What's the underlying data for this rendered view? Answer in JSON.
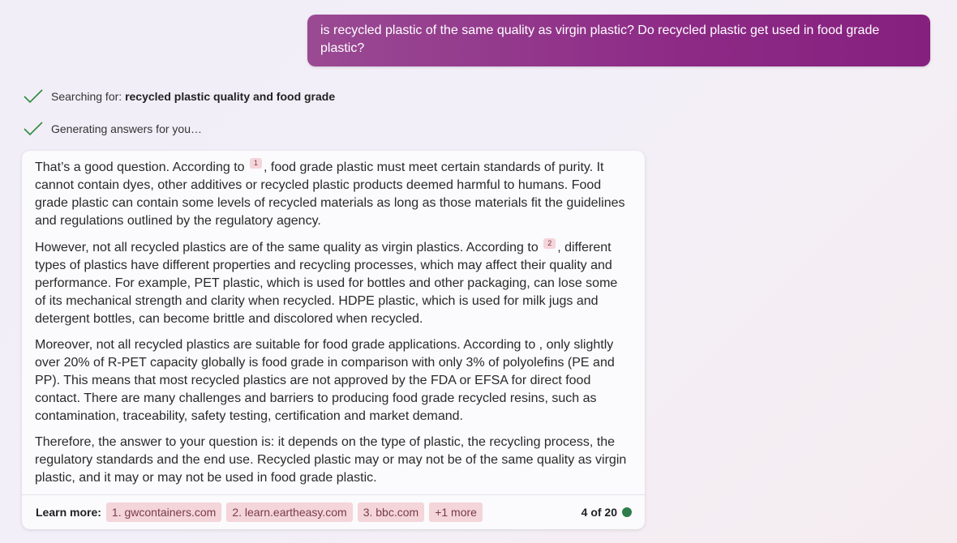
{
  "user_message": "is recycled plastic of the same quality as virgin plastic? Do recycled plastic get used in food grade plastic?",
  "status": {
    "searching_prefix": "Searching for: ",
    "searching_query": "recycled plastic quality and food grade",
    "generating": "Generating answers for you…"
  },
  "answer": {
    "p1_a": "That’s a good question. According to ",
    "p1_cite": "1",
    "p1_b": ", food grade plastic must meet certain standards of purity. It cannot contain dyes, other additives or recycled plastic products deemed harmful to humans. Food grade plastic can contain some levels of recycled materials as long as those materials fit the guidelines and regulations outlined by the regulatory agency.",
    "p2_a": "However, not all recycled plastics are of the same quality as virgin plastics. According to ",
    "p2_cite": "2",
    "p2_b": ", different types of plastics have different properties and recycling processes, which may affect their quality and performance. For example, PET plastic, which is used for bottles and other packaging, can lose some of its mechanical strength and clarity when recycled. HDPE plastic, which is used for milk jugs and detergent bottles, can become brittle and discolored when recycled.",
    "p3": "Moreover, not all recycled plastics are suitable for food grade applications. According to , only slightly over 20% of R-PET capacity globally is food grade in comparison with only 3% of polyolefins (PE and PP). This means that most recycled plastics are not approved by the FDA or EFSA for direct food contact. There are many challenges and barriers to producing food grade recycled resins, such as contamination, traceability, safety testing, certification and market demand.",
    "p4": "Therefore, the answer to your question is: it depends on the type of plastic, the recycling process, the regulatory standards and the end use. Recycled plastic may or may not be of the same quality as virgin plastic, and it may or may not be used in food grade plastic."
  },
  "learn_more": {
    "label": "Learn more:",
    "links": [
      "1. gwcontainers.com",
      "2. learn.eartheasy.com",
      "3. bbc.com"
    ],
    "more": "+1 more"
  },
  "turn_count": "4 of 20",
  "colors": {
    "status_dot": "#2e7d4a",
    "check": "#2e8b3a",
    "accent": "#8d2a86"
  },
  "icons": {
    "check": "checkmark-icon"
  }
}
